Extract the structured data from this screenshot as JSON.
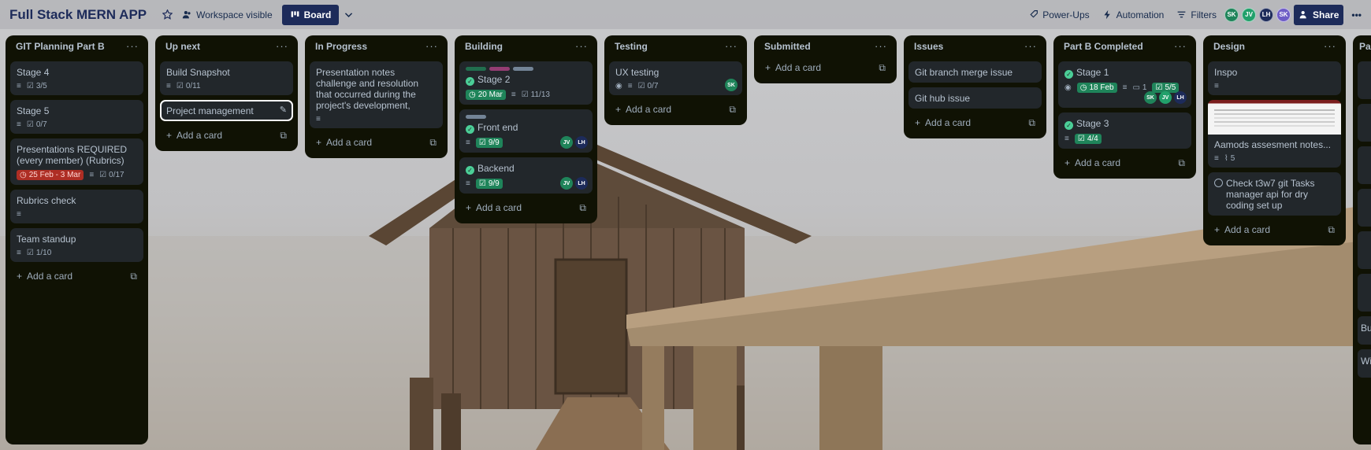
{
  "header": {
    "board_title": "Full Stack MERN APP",
    "visibility_label": "Workspace visible",
    "board_view_label": "Board",
    "powerups_label": "Power-Ups",
    "automation_label": "Automation",
    "filters_label": "Filters",
    "share_label": "Share",
    "members": [
      {
        "initials": "SK",
        "color": "#1f845a"
      },
      {
        "initials": "JV",
        "color": "#22a06b"
      },
      {
        "initials": "LH",
        "color": "#1d2b5a"
      },
      {
        "initials": "SK",
        "color": "#6e5dc6"
      }
    ]
  },
  "add_card_label": "Add a card",
  "lists": [
    {
      "title": "GIT Planning Part B",
      "cards": [
        {
          "title": "Stage 4",
          "checklist": "3/5"
        },
        {
          "title": "Stage 5",
          "checklist": "0/7"
        },
        {
          "title": "Presentations REQUIRED (every member) (Rubrics)",
          "due": "25 Feb - 3 Mar",
          "checklist": "0/17"
        },
        {
          "title": "Rubrics check"
        },
        {
          "title": "Team standup",
          "checklist": "1/10"
        }
      ]
    },
    {
      "title": "Up next",
      "cards": [
        {
          "title": "Build Snapshot",
          "checklist": "0/11"
        },
        {
          "title": "Project management"
        }
      ]
    },
    {
      "title": "In Progress",
      "cards": [
        {
          "title": "Presentation notes challenge and resolution that occurred during the project's development,"
        }
      ]
    },
    {
      "title": "Building",
      "cards": [
        {
          "title": "Stage 2",
          "due": "20 Mar",
          "checklist": "11/13"
        },
        {
          "title": "Front end",
          "checklist": "9/9",
          "members": [
            "JV",
            "LH"
          ]
        },
        {
          "title": "Backend",
          "checklist": "9/9",
          "members": [
            "JV",
            "LH"
          ]
        }
      ]
    },
    {
      "title": "Testing",
      "cards": [
        {
          "title": "UX testing",
          "checklist": "0/7",
          "members": [
            "SK"
          ]
        }
      ]
    },
    {
      "title": "Submitted",
      "cards": []
    },
    {
      "title": "Issues",
      "cards": [
        {
          "title": "Git branch merge issue"
        },
        {
          "title": "Git hub issue"
        }
      ]
    },
    {
      "title": "Part B Completed",
      "cards": [
        {
          "title": "Stage 1",
          "due": "18 Feb",
          "comments": "1",
          "checklist": "5/5",
          "members": [
            "SK",
            "JV",
            "LH"
          ]
        },
        {
          "title": "Stage 3",
          "checklist": "4/4"
        }
      ]
    },
    {
      "title": "Design",
      "cards": [
        {
          "title": "Inspo"
        },
        {
          "title": "Aamods assesment notes...",
          "attachments": "5"
        },
        {
          "title": "Check t3w7 git Tasks manager api for dry coding set up"
        }
      ]
    },
    {
      "title": "Part"
    }
  ],
  "partial_card_texts": [
    "Buil",
    "Wir"
  ],
  "colors": {
    "list_bg": "#101204",
    "card_bg": "#22272b",
    "green": "#1f845a",
    "red": "#ae2e24"
  }
}
